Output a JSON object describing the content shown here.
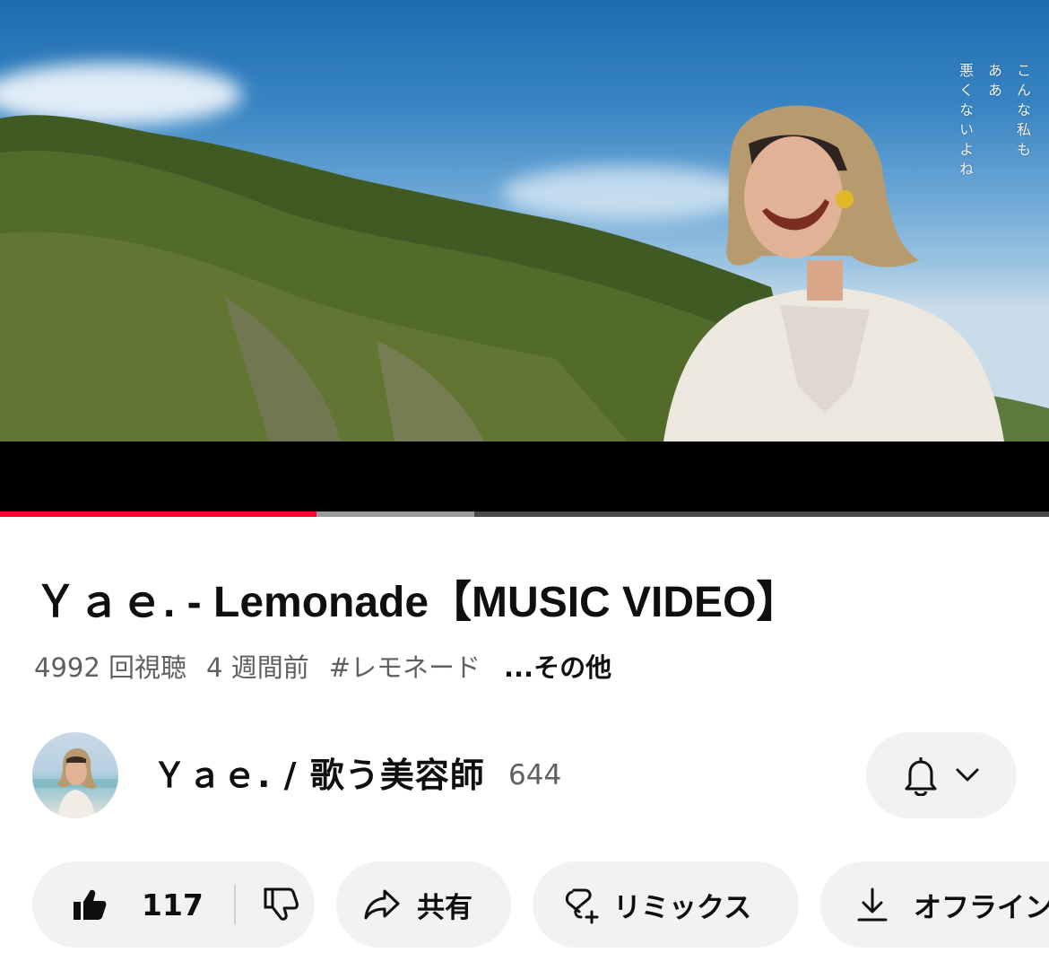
{
  "video": {
    "lyric_columns": [
      "こんな私も",
      "ああ",
      "悪くないよね"
    ],
    "progress_played": 0.302,
    "progress_buffered": 0.452,
    "progress_color": "#ff0033"
  },
  "title": "Ｙａｅ.  -  Lemonade【MUSIC VIDEO】",
  "meta": {
    "views": "4992 回視聴",
    "age": "4 週間前",
    "hashtag": "#レモネード",
    "more": "...その他"
  },
  "channel": {
    "name": "Ｙａｅ. / 歌う美容師",
    "subscribers": "644",
    "avatar_icon": "channel-avatar",
    "bell_icon": "bell-icon",
    "chevron_icon": "chevron-down-icon"
  },
  "actions": {
    "like_count": "117",
    "share_label": "共有",
    "remix_label": "リミックス",
    "offline_label": "オフライン"
  }
}
